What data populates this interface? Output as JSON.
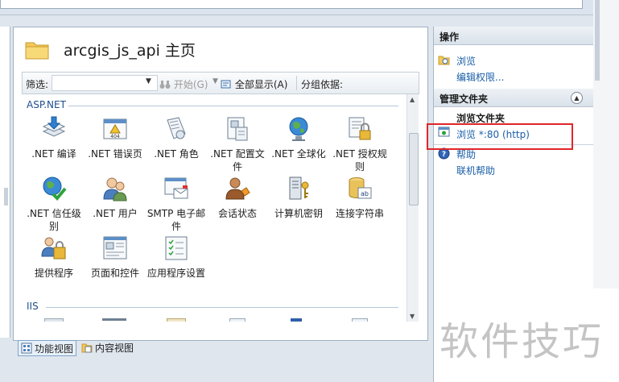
{
  "page": {
    "title": "arcgis_js_api 主页"
  },
  "toolbar": {
    "filter_label": "筛选:",
    "start_label": "开始(G)",
    "show_all_label": "全部显示(A)",
    "group_by_label": "分组依据:"
  },
  "groups": [
    {
      "name": "ASP.NET",
      "items": [
        {
          "label": ".NET 编译",
          "icon": "net-compile-icon"
        },
        {
          "label": ".NET 错误页",
          "icon": "net-error-pages-icon"
        },
        {
          "label": ".NET 角色",
          "icon": "net-roles-icon"
        },
        {
          "label": ".NET 配置文件",
          "icon": "net-profile-icon"
        },
        {
          "label": ".NET 全球化",
          "icon": "net-globalization-icon"
        },
        {
          "label": ".NET 授权规则",
          "icon": "net-authorization-rules-icon"
        },
        {
          "label": ".NET 信任级别",
          "icon": "net-trust-levels-icon"
        },
        {
          "label": ".NET 用户",
          "icon": "net-users-icon"
        },
        {
          "label": "SMTP 电子邮件",
          "icon": "smtp-email-icon"
        },
        {
          "label": "会话状态",
          "icon": "session-state-icon"
        },
        {
          "label": "计算机密钥",
          "icon": "machine-key-icon"
        },
        {
          "label": "连接字符串",
          "icon": "connection-strings-icon"
        },
        {
          "label": "提供程序",
          "icon": "providers-icon"
        },
        {
          "label": "页面和控件",
          "icon": "pages-and-controls-icon"
        },
        {
          "label": "应用程序设置",
          "icon": "application-settings-icon"
        }
      ]
    },
    {
      "name": "IIS",
      "items": []
    }
  ],
  "views": {
    "features_label": "功能视图",
    "content_label": "内容视图"
  },
  "actions": {
    "header": "操作",
    "explore_label": "浏览",
    "edit_permissions_label": "编辑权限...",
    "manage_folder_header": "管理文件夹",
    "browse_folder_label": "浏览文件夹",
    "browse_port_label": "浏览 *:80 (http)",
    "help_label": "帮助",
    "online_help_label": "联机帮助"
  },
  "watermark": "软件技巧",
  "colors": {
    "link": "#1a5fa8",
    "group_header": "#1f4e8c",
    "highlight_box": "#e0262a"
  }
}
